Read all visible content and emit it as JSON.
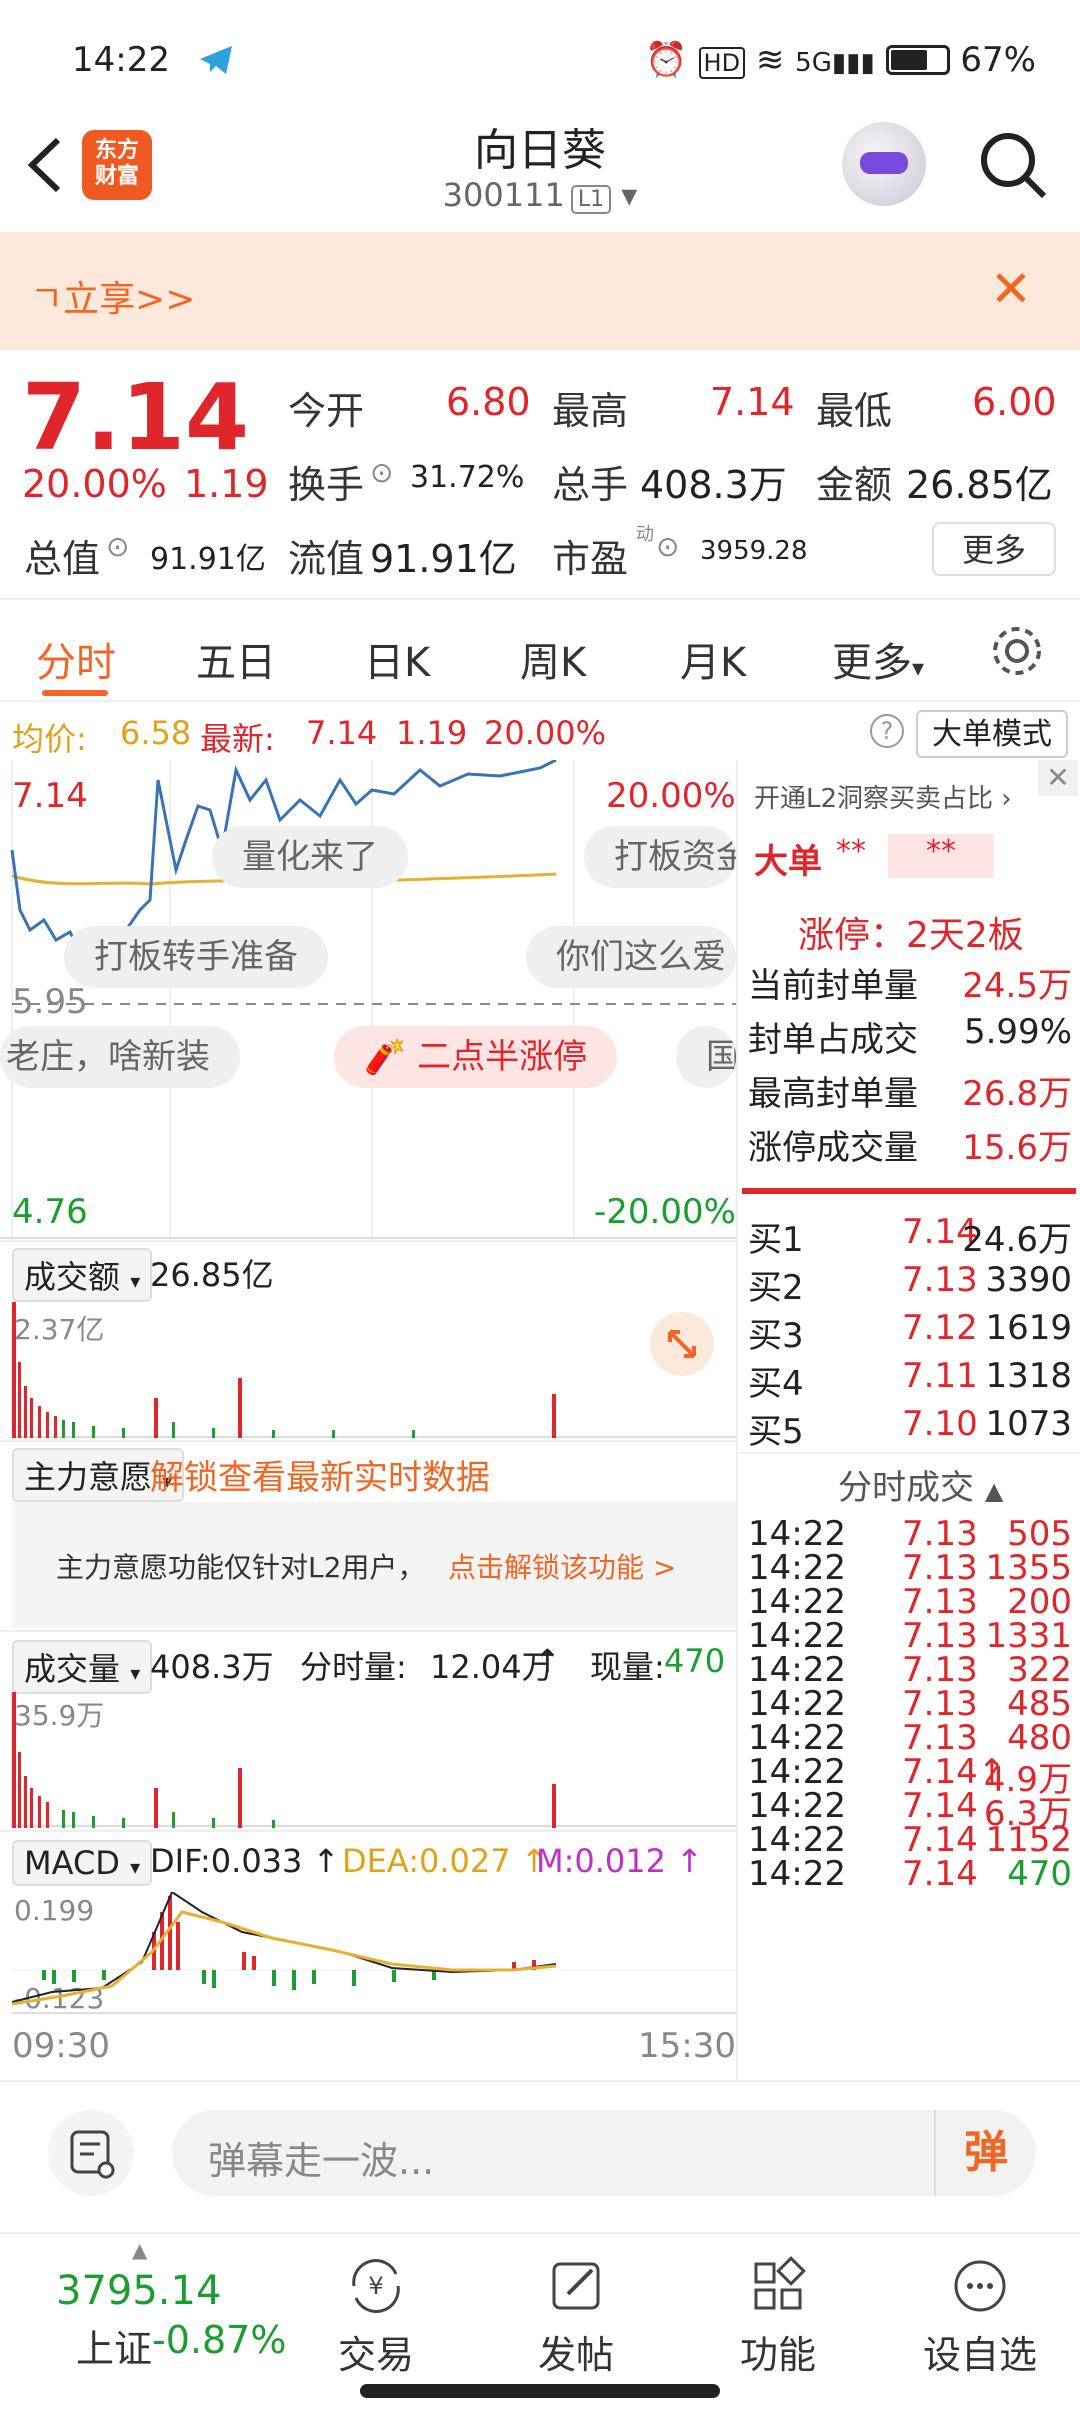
{
  "status": {
    "time": "14:22",
    "battery": "67%"
  },
  "header": {
    "back_icon": "back-arrow-icon",
    "logo_text": "东方\n财富",
    "title": "向日葵",
    "code": "300111",
    "level": "L1"
  },
  "promo": {
    "text": "ㄱ立享>>"
  },
  "quote": {
    "price": "7.14",
    "pct": "20.00%",
    "change": "1.19",
    "open_label": "今开",
    "open": "6.80",
    "high_label": "最高",
    "high": "7.14",
    "low_label": "最低",
    "low": "6.00",
    "turnover_label": "换手",
    "turnover": "31.72%",
    "vol_label": "总手",
    "vol": "408.3万",
    "amount_label": "金额",
    "amount": "26.85亿",
    "mktcap_label": "总值",
    "mktcap": "91.91亿",
    "float_label": "流值",
    "float": "91.91亿",
    "pe_label": "市盈",
    "pe_sup": "动",
    "pe": "3959.28",
    "more": "更多"
  },
  "tabs": [
    "分时",
    "五日",
    "日K",
    "周K",
    "月K",
    "更多"
  ],
  "meta": {
    "avg_label": "均价:",
    "avg": "6.58",
    "last_label": "最新:",
    "last": "7.14",
    "chg": "1.19",
    "pct": "20.00%",
    "bigmode": "大单模式"
  },
  "chart": {
    "top_price": "7.14",
    "top_pct": "20.00%",
    "mid_price": "5.95",
    "bottom_price": "4.76",
    "bottom_pct": "-20.00%",
    "bubbles": [
      "量化来了",
      "打板资金",
      "打板转手准备",
      "你们这么爱",
      "老庄，啥新装",
      "二点半涨停",
      "国"
    ]
  },
  "indicators": {
    "amount_label": "成交额",
    "amount": "26.85亿",
    "amount_max": "2.37亿",
    "main_label": "主力意愿",
    "main_lock": "解锁查看最新实时数据",
    "main_note": "主力意愿功能仅针对L2用户，",
    "main_unlock": "点击解锁该功能 >",
    "vol_label": "成交量",
    "vol": "408.3万",
    "fsl_label": "分时量:",
    "fsl": "12.04万",
    "xl_label": "现量:",
    "xl": "470",
    "vol_max": "35.9万",
    "macd_label": "MACD",
    "dif": "DIF:0.033",
    "dea": "DEA:0.027",
    "m": "M:0.012",
    "macd_top": "0.199",
    "macd_bottom": "-0.123",
    "t_start": "09:30",
    "t_end": "15:30"
  },
  "right": {
    "l2": "开通L2洞察买卖占比",
    "bigorder": "大单",
    "stars1": "**",
    "stars2": "**",
    "limitup": "涨停：2天2板",
    "rows": [
      {
        "label": "当前封单量",
        "value": "24.5万"
      },
      {
        "label": "封单占成交",
        "value": "5.99%"
      },
      {
        "label": "最高封单量",
        "value": "26.8万"
      },
      {
        "label": "涨停成交量",
        "value": "15.6万"
      }
    ],
    "bids": [
      {
        "label": "买1",
        "price": "7.14",
        "vol": "24.6万"
      },
      {
        "label": "买2",
        "price": "7.13",
        "vol": "3390"
      },
      {
        "label": "买3",
        "price": "7.12",
        "vol": "1619"
      },
      {
        "label": "买4",
        "price": "7.11",
        "vol": "1318"
      },
      {
        "label": "买5",
        "price": "7.10",
        "vol": "1073"
      }
    ],
    "ticks_title": "分时成交",
    "ticks": [
      {
        "t": "14:22",
        "p": "7.13",
        "v": "505"
      },
      {
        "t": "14:22",
        "p": "7.13",
        "v": "1355"
      },
      {
        "t": "14:22",
        "p": "7.13",
        "v": "200"
      },
      {
        "t": "14:22",
        "p": "7.13",
        "v": "1331"
      },
      {
        "t": "14:22",
        "p": "7.13",
        "v": "322"
      },
      {
        "t": "14:22",
        "p": "7.13",
        "v": "485"
      },
      {
        "t": "14:22",
        "p": "7.13",
        "v": "480"
      },
      {
        "t": "14:22",
        "p": "7.14↑",
        "v": "4.9万"
      },
      {
        "t": "14:22",
        "p": "7.14",
        "v": "6.3万"
      },
      {
        "t": "14:22",
        "p": "7.14",
        "v": "1152"
      },
      {
        "t": "14:22",
        "p": "7.14",
        "v": "470"
      }
    ]
  },
  "comment": {
    "placeholder": "弹幕走一波...",
    "send": "弹"
  },
  "nav": {
    "index_value": "3795.14",
    "index_name": "上证",
    "index_pct": "-0.87%",
    "items": [
      "交易",
      "发帖",
      "功能",
      "设自选"
    ]
  }
}
